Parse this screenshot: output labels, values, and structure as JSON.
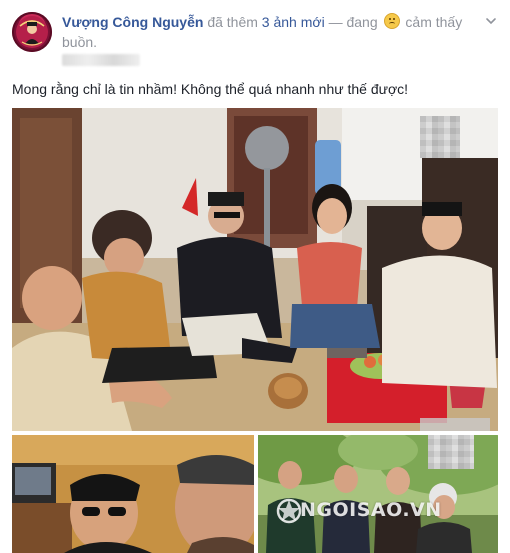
{
  "post": {
    "author": "Vượng Công Nguyễn",
    "action_prefix": "đã thêm",
    "photo_count_link": "3 ảnh mới",
    "activity_prefix": "— đang",
    "feeling_icon": "sad-face-emoji",
    "feeling_text": "cảm thấy buồn.",
    "status_text": "Mong rằng chỉ là tin nhầm! Không thể quá nhanh như thế được!",
    "options_icon": "chevron-down-icon",
    "watermark_text": "NGOISAO.VN",
    "avatar_icon": "profile-avatar-icon"
  },
  "colors": {
    "link": "#365899",
    "meta_text": "#90949c",
    "body_text": "#1d2129"
  }
}
